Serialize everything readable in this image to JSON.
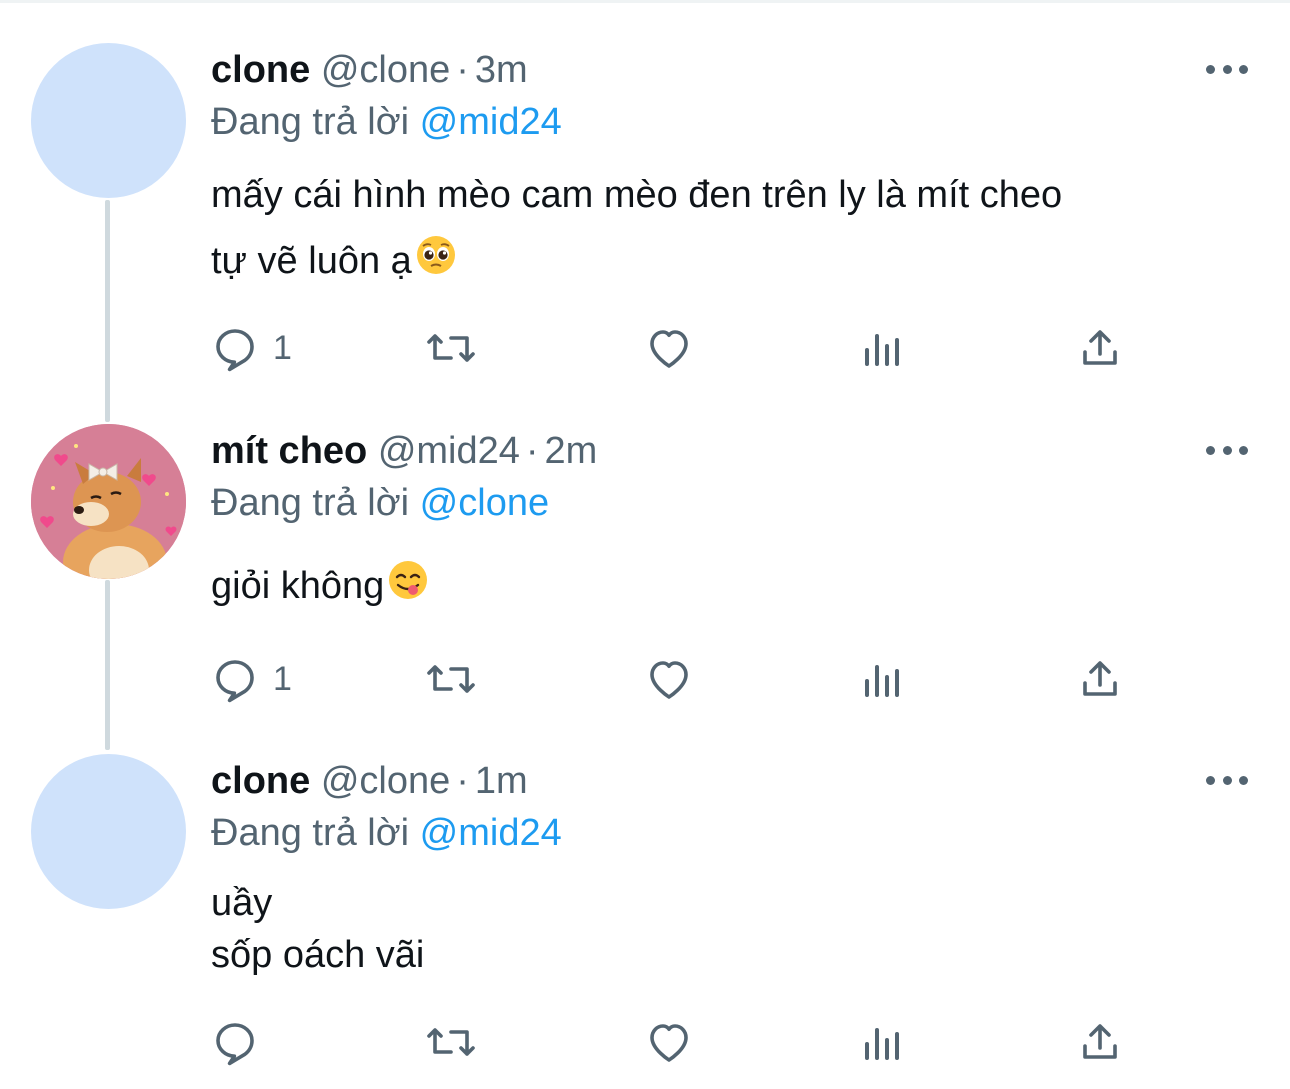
{
  "reply_prefix": "Đang trả lời",
  "separator": "·",
  "tweets": [
    {
      "name": "clone",
      "handle": "@clone",
      "time": "3m",
      "reply_to": "@mid24",
      "lines": [
        "mấy cái hình mèo cam mèo đen trên ly là mít cheo",
        "tự vẽ luôn ạ"
      ],
      "emoji": "pleading-face-emoji",
      "reply_count": "1"
    },
    {
      "name": "mít cheo",
      "handle": "@mid24",
      "time": "2m",
      "reply_to": "@clone",
      "lines": [
        "giỏi không"
      ],
      "emoji": "yum-face-emoji",
      "reply_count": "1"
    },
    {
      "name": "clone",
      "handle": "@clone",
      "time": "1m",
      "reply_to": "@mid24",
      "lines": [
        "uầy",
        "sốp oách vãi"
      ],
      "reply_count": ""
    }
  ],
  "colors": {
    "text_primary": "#0f1419",
    "text_secondary": "#536471",
    "mention": "#1d9bf0",
    "avatar_placeholder": "#cfe2fb",
    "thread_line": "#cfd9de"
  }
}
